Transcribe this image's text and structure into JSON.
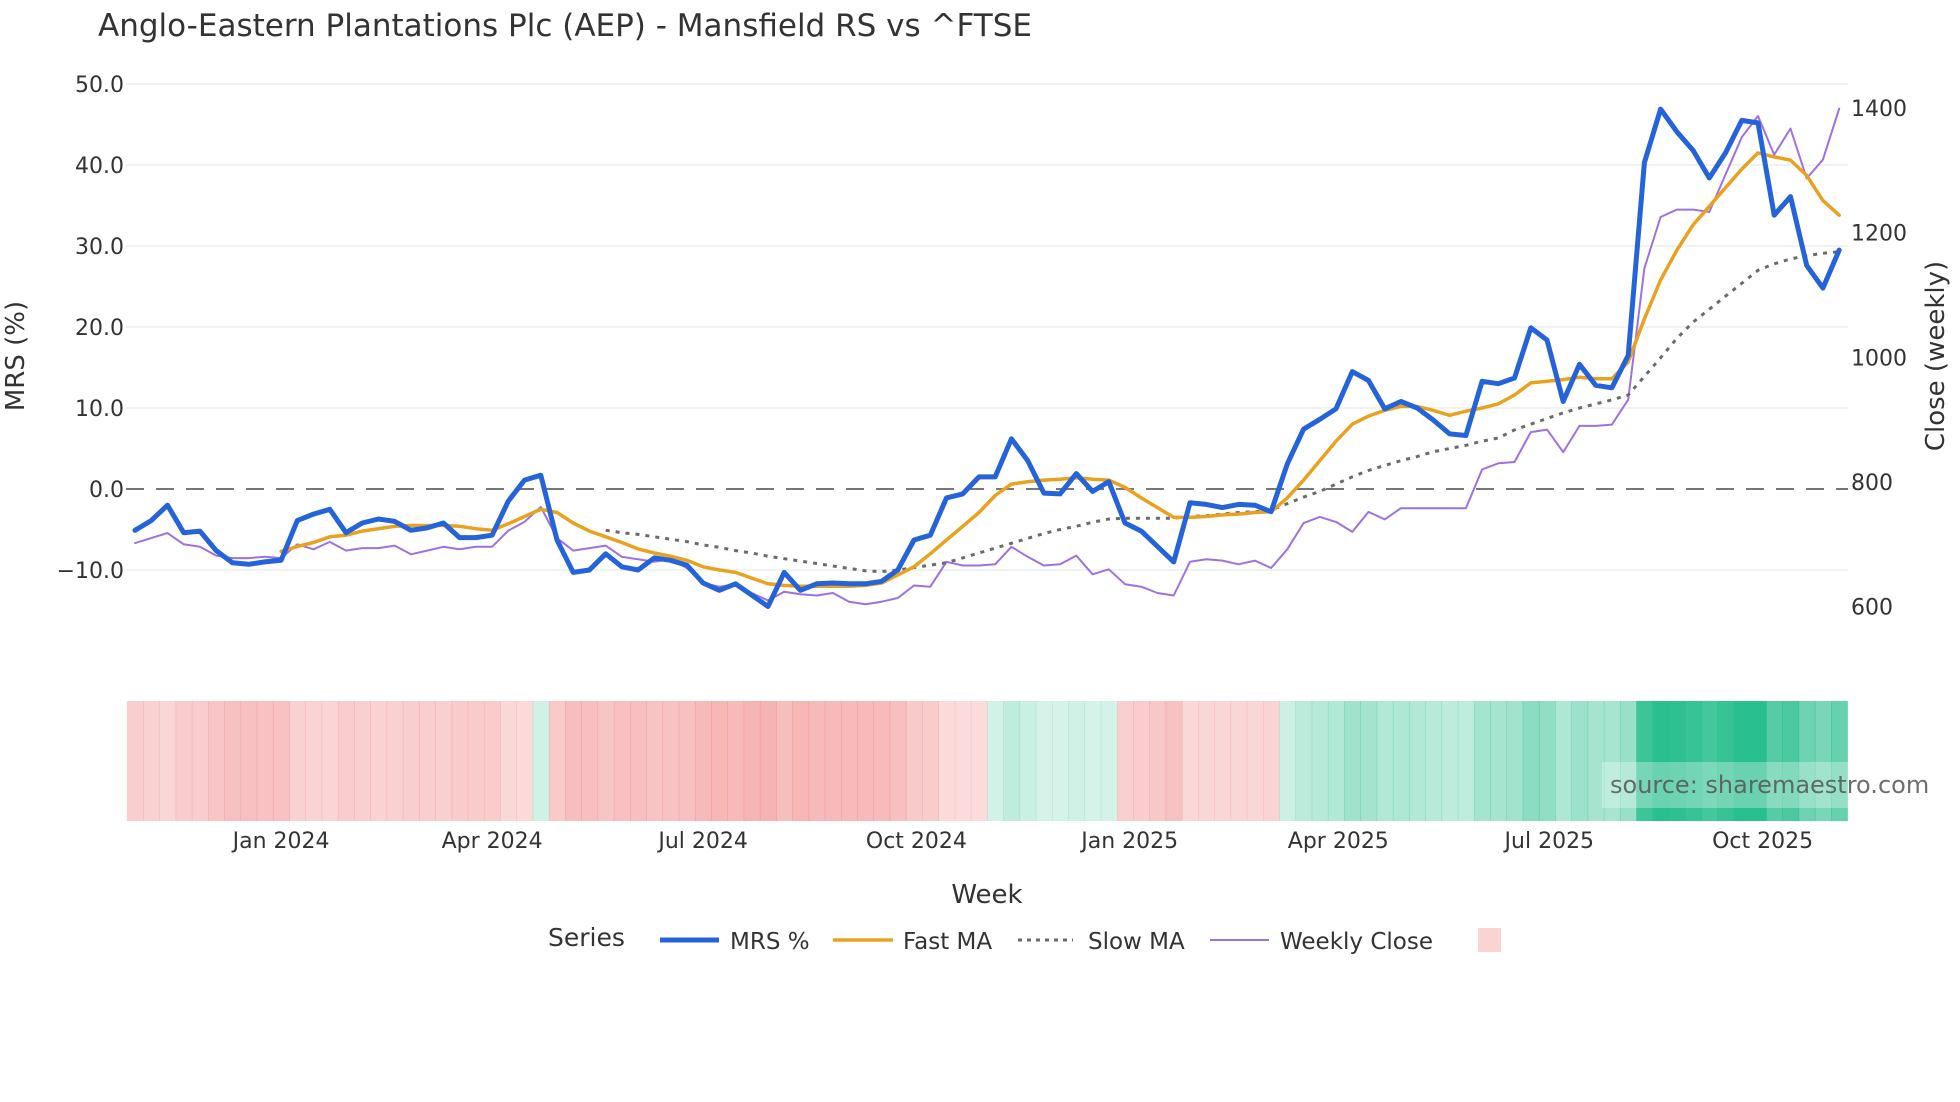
{
  "title": "Anglo-Eastern Plantations Plc (AEP) - Mansfield RS vs ^FTSE",
  "source": "source: sharemaestro.com",
  "chart_data": {
    "type": "line",
    "title": "Anglo-Eastern Plantations Plc (AEP) - Mansfield RS vs ^FTSE",
    "xlabel": "Week",
    "ylabel": "MRS (%)",
    "y2label": "Close (weekly)",
    "x_start": "2023-10-30",
    "x_step_days": 7,
    "ylim": [
      -16,
      52
    ],
    "y2lim": [
      600,
      1400
    ],
    "yticks": [
      "50.0",
      "40.0",
      "30.0",
      "20.0",
      "10.0",
      "0.0",
      "−10.0"
    ],
    "ytick_values": [
      50,
      40,
      30,
      20,
      10,
      0,
      -10
    ],
    "y2ticks": [
      "1400",
      "1200",
      "1000",
      "800",
      "600"
    ],
    "y2tick_values": [
      1400,
      1200,
      1000,
      800,
      600
    ],
    "xticks": [
      "Jan 2024",
      "Apr 2024",
      "Jul 2024",
      "Oct 2024",
      "Jan 2025",
      "Apr 2025",
      "Jul 2025",
      "Oct 2025"
    ],
    "xtick_dates": [
      "2024-01-01",
      "2024-04-01",
      "2024-07-01",
      "2024-10-01",
      "2025-01-01",
      "2025-04-01",
      "2025-07-01",
      "2025-10-01"
    ],
    "reference_line": 0,
    "grid": true,
    "legend": {
      "title": "Series",
      "placement": "bottom-center",
      "items": [
        "MRS %",
        "Fast MA",
        "Slow MA",
        "Weekly Close",
        ""
      ]
    },
    "colors": {
      "mrs": "#2563db",
      "fast": "#e9a21f",
      "slow": "#6b6b6b",
      "close": "#9c72e2",
      "heat_neg": "#f08080",
      "heat_pos": "#26be8c",
      "grid": "#eceff4",
      "zero": "#777777"
    },
    "series": [
      {
        "name": "MRS %",
        "key": "mrs",
        "axis": "left",
        "values": [
          -5.1,
          -3.9,
          -2.0,
          -5.4,
          -5.2,
          -7.6,
          -9.1,
          -9.3,
          -9.0,
          -8.8,
          -3.9,
          -3.1,
          -2.5,
          -5.4,
          -4.2,
          -3.7,
          -4.0,
          -5.1,
          -4.8,
          -4.2,
          -6.0,
          -6.0,
          -5.7,
          -1.5,
          1.1,
          1.7,
          -6.3,
          -10.3,
          -10.0,
          -8.0,
          -9.6,
          -10.0,
          -8.5,
          -8.8,
          -9.4,
          -11.6,
          -12.5,
          -11.7,
          -13.1,
          -14.5,
          -10.3,
          -12.5,
          -11.7,
          -11.6,
          -11.7,
          -11.7,
          -11.4,
          -10.0,
          -6.3,
          -5.7,
          -1.1,
          -0.6,
          1.5,
          1.5,
          6.2,
          3.5,
          -0.5,
          -0.6,
          1.9,
          -0.3,
          0.9,
          -4.2,
          -5.2,
          -7.1,
          -9.0,
          -1.7,
          -1.9,
          -2.3,
          -1.9,
          -2.0,
          -2.8,
          3.1,
          7.4,
          8.6,
          9.9,
          14.5,
          13.4,
          9.9,
          10.8,
          10.0,
          8.5,
          6.8,
          6.6,
          13.3,
          13.0,
          13.7,
          19.9,
          18.4,
          10.8,
          15.4,
          12.8,
          12.5,
          16.5,
          40.3,
          46.9,
          44.1,
          41.8,
          38.4,
          41.5,
          45.5,
          45.2,
          33.8,
          36.1,
          27.6,
          24.8,
          29.5
        ]
      },
      {
        "name": "Fast MA",
        "key": "fast",
        "axis": "left",
        "values": [
          null,
          null,
          null,
          null,
          null,
          null,
          null,
          null,
          null,
          -7.7,
          -7.1,
          -6.6,
          -5.9,
          -5.7,
          -5.2,
          -4.9,
          -4.6,
          -4.5,
          -4.5,
          -4.5,
          -4.6,
          -4.9,
          -5.1,
          -4.3,
          -3.4,
          -2.5,
          -2.9,
          -4.2,
          -5.2,
          -5.9,
          -6.6,
          -7.4,
          -7.9,
          -8.3,
          -8.8,
          -9.6,
          -10.0,
          -10.3,
          -11.0,
          -11.7,
          -11.9,
          -12.0,
          -12.0,
          -12.0,
          -12.0,
          -11.9,
          -11.6,
          -10.6,
          -9.6,
          -8.0,
          -6.3,
          -4.6,
          -2.9,
          -0.8,
          0.6,
          0.9,
          1.1,
          1.2,
          1.4,
          1.2,
          1.1,
          0.2,
          -1.1,
          -2.3,
          -3.5,
          -3.5,
          -3.4,
          -3.2,
          -3.1,
          -2.9,
          -2.8,
          -1.1,
          1.1,
          3.5,
          5.9,
          8.0,
          9.0,
          9.7,
          10.2,
          10.2,
          9.7,
          9.1,
          9.6,
          10.0,
          10.5,
          11.6,
          13.1,
          13.3,
          13.5,
          13.8,
          13.6,
          13.6,
          15.7,
          21.0,
          25.8,
          29.5,
          32.6,
          34.9,
          37.2,
          39.5,
          41.5,
          41.0,
          40.6,
          38.7,
          35.6,
          33.8
        ]
      },
      {
        "name": "Slow MA",
        "key": "slow",
        "axis": "left",
        "values": [
          null,
          null,
          null,
          null,
          null,
          null,
          null,
          null,
          null,
          null,
          null,
          null,
          null,
          null,
          null,
          null,
          null,
          null,
          null,
          null,
          null,
          null,
          null,
          null,
          null,
          null,
          null,
          null,
          null,
          -5.1,
          -5.4,
          -5.6,
          -5.9,
          -6.2,
          -6.5,
          -6.9,
          -7.2,
          -7.6,
          -7.9,
          -8.3,
          -8.6,
          -8.9,
          -9.2,
          -9.5,
          -9.8,
          -10.1,
          -10.2,
          -10.0,
          -9.7,
          -9.4,
          -9.1,
          -8.5,
          -7.9,
          -7.3,
          -6.7,
          -6.1,
          -5.5,
          -5.0,
          -4.6,
          -4.1,
          -3.7,
          -3.6,
          -3.6,
          -3.6,
          -3.6,
          -3.4,
          -3.3,
          -3.1,
          -2.9,
          -2.8,
          -2.6,
          -1.8,
          -1.0,
          -0.3,
          0.6,
          1.5,
          2.3,
          2.9,
          3.5,
          4.0,
          4.6,
          5.0,
          5.4,
          5.9,
          6.3,
          7.3,
          8.0,
          8.7,
          9.4,
          10.0,
          10.5,
          11.0,
          11.6,
          13.9,
          16.2,
          18.6,
          20.6,
          22.2,
          23.8,
          25.4,
          27.0,
          27.8,
          28.4,
          28.8,
          29.1,
          29.3
        ]
      },
      {
        "name": "Weekly Close",
        "key": "close",
        "axis": "right",
        "values": [
          702,
          710,
          718,
          700,
          696,
          682,
          678,
          678,
          680,
          678,
          700,
          692,
          704,
          690,
          694,
          694,
          698,
          684,
          690,
          696,
          692,
          696,
          696,
          722,
          736,
          760,
          710,
          690,
          694,
          698,
          680,
          676,
          672,
          676,
          662,
          638,
          632,
          636,
          622,
          610,
          624,
          620,
          618,
          622,
          608,
          604,
          608,
          614,
          634,
          632,
          672,
          666,
          666,
          668,
          696,
          680,
          666,
          668,
          682,
          652,
          660,
          636,
          632,
          622,
          618,
          672,
          676,
          674,
          668,
          674,
          662,
          692,
          734,
          744,
          736,
          720,
          752,
          740,
          758,
          758,
          758,
          758,
          758,
          820,
          830,
          832,
          880,
          884,
          848,
          890,
          890,
          892,
          932,
          1143,
          1225,
          1237,
          1237,
          1233,
          1293,
          1353,
          1387,
          1325,
          1367,
          1287,
          1317,
          1399
        ]
      }
    ],
    "heatmap": [
      -5.1,
      -3.9,
      -2.0,
      -5.4,
      -5.2,
      -7.6,
      -9.1,
      -9.3,
      -9.0,
      -8.8,
      -3.9,
      -3.1,
      -2.5,
      -5.4,
      -4.2,
      -3.7,
      -4.0,
      -5.1,
      -4.8,
      -4.2,
      -6.0,
      -6.0,
      -5.7,
      -1.5,
      -0.8,
      1.7,
      -6.3,
      -10.3,
      -10.0,
      -8.0,
      -9.6,
      -10.0,
      -8.5,
      -8.8,
      -9.4,
      -11.6,
      -12.5,
      -11.7,
      -13.1,
      -14.5,
      -10.3,
      -12.5,
      -11.7,
      -11.6,
      -11.7,
      -11.7,
      -11.4,
      -10.0,
      -6.3,
      -5.7,
      -1.1,
      -0.6,
      -0.5,
      1.5,
      6.2,
      3.5,
      0.5,
      0.5,
      1.9,
      0.5,
      0.9,
      -4.2,
      -5.2,
      -7.1,
      -9.0,
      -1.7,
      -1.9,
      -2.3,
      -1.9,
      -2.0,
      -2.8,
      3.1,
      7.4,
      8.6,
      9.9,
      14.5,
      13.4,
      9.9,
      10.8,
      10.0,
      8.5,
      6.8,
      6.6,
      13.3,
      13.0,
      13.7,
      19.9,
      18.4,
      10.8,
      15.4,
      12.8,
      12.5,
      16.5,
      40.3,
      46.9,
      44.1,
      41.8,
      38.4,
      41.5,
      45.5,
      45.2,
      33.8,
      36.1,
      27.6,
      24.8,
      29.5
    ]
  }
}
